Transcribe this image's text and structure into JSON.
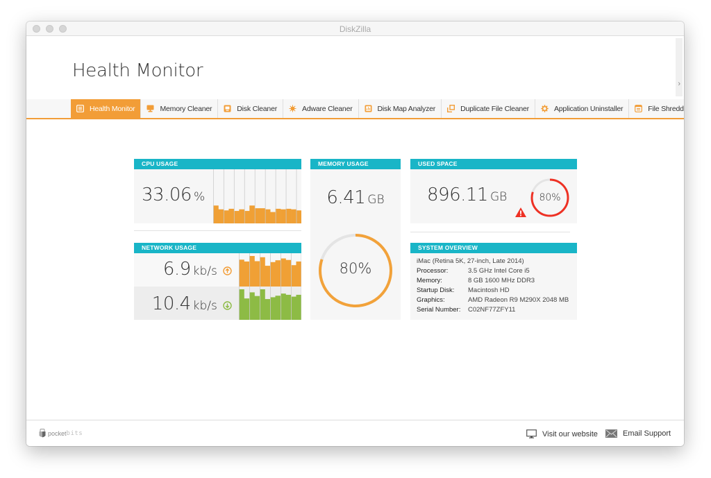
{
  "window": {
    "title": "DiskZilla"
  },
  "header": {
    "title": "Health Monitor"
  },
  "tabs": [
    {
      "label": "Health Monitor",
      "icon": "health-monitor-icon",
      "active": true
    },
    {
      "label": "Memory Cleaner",
      "icon": "monitor-icon",
      "active": false
    },
    {
      "label": "Disk Cleaner",
      "icon": "disk-icon",
      "active": false
    },
    {
      "label": "Adware Cleaner",
      "icon": "bug-icon",
      "active": false
    },
    {
      "label": "Disk Map Analyzer",
      "icon": "chart-icon",
      "active": false
    },
    {
      "label": "Duplicate File Cleaner",
      "icon": "duplicate-icon",
      "active": false
    },
    {
      "label": "Application Uninstaller",
      "icon": "gear-icon",
      "active": false
    },
    {
      "label": "File Shredder",
      "icon": "shredder-icon",
      "active": false
    }
  ],
  "colors": {
    "accent": "#f29d37",
    "header": "#19b5c7",
    "orange_bar": "#f0a035",
    "green_bar": "#8dbb45",
    "alert": "#ee3124",
    "ring_track": "#e4e4e4"
  },
  "cpu": {
    "label": "CPU USAGE",
    "value": "33.06",
    "unit": "%",
    "history": [
      0.33,
      0.26,
      0.24,
      0.27,
      0.23,
      0.26,
      0.23,
      0.33,
      0.28,
      0.28,
      0.26,
      0.21,
      0.27,
      0.26,
      0.27,
      0.26,
      0.24
    ]
  },
  "memory": {
    "label": "MEMORY USAGE",
    "value": "6.41",
    "unit": "GB",
    "percent_label": "80%",
    "percent": 0.8
  },
  "used_space": {
    "label": "USED SPACE",
    "value": "896.11",
    "unit": "GB",
    "percent_label": "80%",
    "percent": 0.8,
    "warning_icon": "warning-icon"
  },
  "network": {
    "label": "NETWORK USAGE",
    "upload": {
      "value": "6.9",
      "unit": "kb/s",
      "icon": "arrow-up-icon",
      "history": [
        0.88,
        0.82,
        1.0,
        0.83,
        0.96,
        0.68,
        0.8,
        0.86,
        0.92,
        0.87,
        0.7,
        0.82
      ]
    },
    "download": {
      "value": "10.4",
      "unit": "kb/s",
      "icon": "arrow-down-icon",
      "history": [
        1.0,
        0.7,
        0.9,
        0.78,
        1.0,
        0.68,
        0.74,
        0.79,
        0.86,
        0.82,
        0.76,
        0.82
      ]
    }
  },
  "system": {
    "label": "SYSTEM OVERVIEW",
    "model": "iMac (Retina 5K, 27-inch, Late 2014)",
    "rows": [
      {
        "label": "Processor:",
        "value": "3.5 GHz Intel Core i5"
      },
      {
        "label": "Memory:",
        "value": "8 GB 1600 MHz DDR3"
      },
      {
        "label": "Startup Disk:",
        "value": "Macintosh HD"
      },
      {
        "label": "Graphics:",
        "value": "AMD Radeon R9 M290X 2048 MB"
      },
      {
        "label": "Serial Number:",
        "value": "C02NF77ZFY11"
      }
    ]
  },
  "footer": {
    "logo_a": "pocket",
    "logo_b": "bits",
    "website_label": "Visit our website",
    "email_label": "Email Support"
  }
}
